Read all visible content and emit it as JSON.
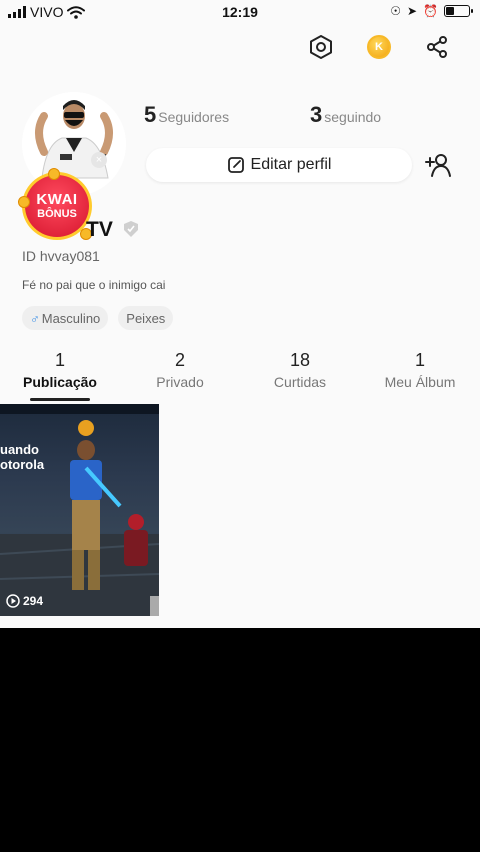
{
  "status_bar": {
    "carrier": "VIVO",
    "time": "12:19"
  },
  "profile": {
    "followers_count": "5",
    "followers_label": "Seguidores",
    "following_count": "3",
    "following_label": "seguindo",
    "edit_label": "Editar perfil",
    "name": "TV",
    "id_text": "ID hvvay081",
    "bio": "Fé no pai que o inimigo cai",
    "tags": [
      "Masculino",
      "Peixes"
    ],
    "bonus_line1": "KWAI",
    "bonus_line2": "BÔNUS"
  },
  "tabs": [
    {
      "count": "1",
      "label": "Publicação"
    },
    {
      "count": "2",
      "label": "Privado"
    },
    {
      "count": "18",
      "label": "Curtidas"
    },
    {
      "count": "1",
      "label": "Meu Álbum"
    }
  ],
  "posts": [
    {
      "caption_line1": "uando",
      "caption_line2": "otorola",
      "views": "294"
    }
  ],
  "colors": {
    "accent_coin": "#f7b928",
    "bonus_red": "#d5142c",
    "background": "#fafafa"
  },
  "icons": [
    "wifi-icon",
    "battery-icon",
    "settings-hexagon-icon",
    "coin-icon",
    "share-icon",
    "edit-icon",
    "add-friend-icon",
    "verified-icon",
    "play-icon"
  ]
}
